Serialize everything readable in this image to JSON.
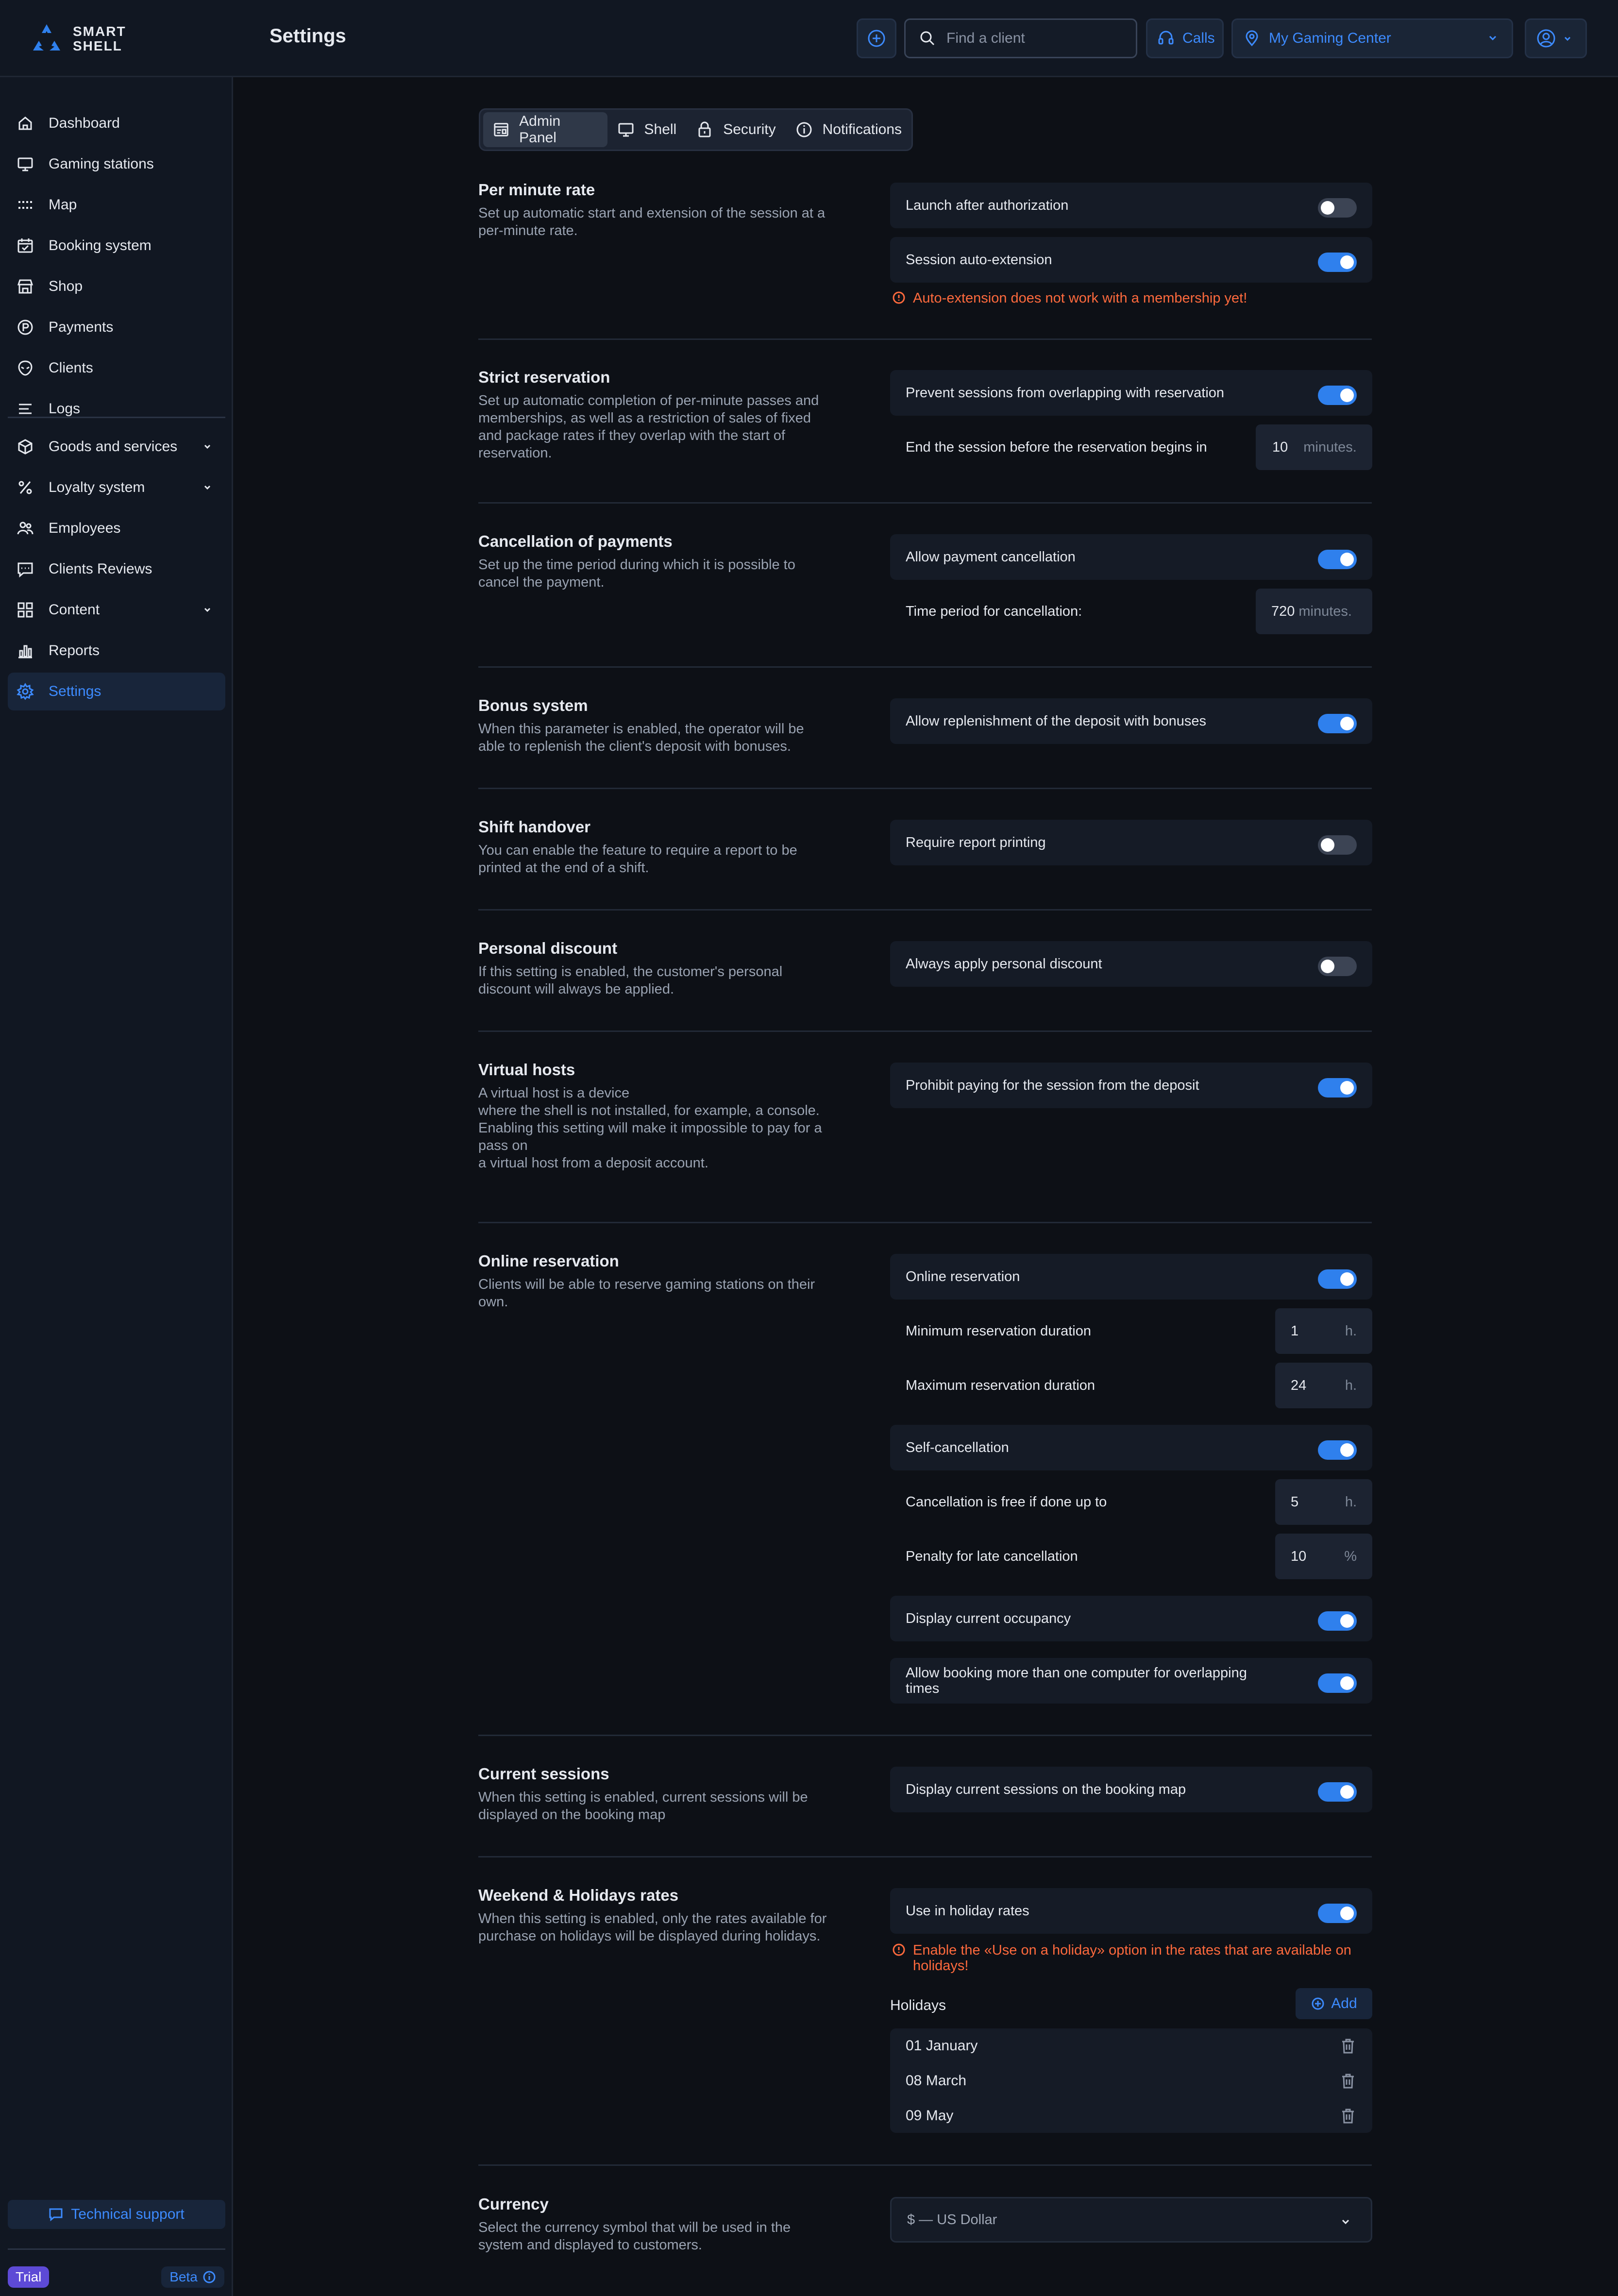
{
  "app": {
    "logo_text_1": "SMART",
    "logo_text_2": "SHELL",
    "page_title": "Settings"
  },
  "header": {
    "search_placeholder": "Find a client",
    "calls_label": "Calls",
    "center_name": "My Gaming Center"
  },
  "sidebar": {
    "items": [
      {
        "label": "Dashboard",
        "icon": "home-icon"
      },
      {
        "label": "Gaming stations",
        "icon": "monitor-icon"
      },
      {
        "label": "Map",
        "icon": "grid-dots-icon"
      },
      {
        "label": "Booking system",
        "icon": "calendar-icon"
      },
      {
        "label": "Shop",
        "icon": "store-icon"
      },
      {
        "label": "Payments",
        "icon": "coin-icon"
      },
      {
        "label": "Clients",
        "icon": "alien-icon"
      },
      {
        "label": "Logs",
        "icon": "list-icon"
      },
      {
        "label": "Goods and services",
        "icon": "box-icon"
      },
      {
        "label": "Loyalty system",
        "icon": "percent-icon"
      },
      {
        "label": "Employees",
        "icon": "people-icon"
      },
      {
        "label": "Clients Reviews",
        "icon": "comment-icon"
      },
      {
        "label": "Content",
        "icon": "blocks-icon"
      },
      {
        "label": "Reports",
        "icon": "bar-chart-icon"
      },
      {
        "label": "Settings",
        "icon": "gear-icon"
      }
    ],
    "support_label": "Technical support",
    "trial_label": "Trial",
    "beta_label": "Beta"
  },
  "tabs": [
    {
      "label": "Admin Panel",
      "icon": "admin-panel-icon"
    },
    {
      "label": "Shell",
      "icon": "monitor-icon"
    },
    {
      "label": "Security",
      "icon": "lock-icon"
    },
    {
      "label": "Notifications",
      "icon": "info-icon"
    }
  ],
  "sections": {
    "per_minute": {
      "title": "Per minute rate",
      "desc": "Set up automatic start and extension of the session at a per-minute rate.",
      "launch_after_auth": "Launch after authorization",
      "auto_extension": "Session auto-extension",
      "warning": "Auto-extension does not work with a membership yet!"
    },
    "strict": {
      "title": "Strict reservation",
      "desc": "Set up automatic completion of per-minute passes and memberships, as well as a restriction of sales of fixed and package rates if they overlap with the start of reservation.",
      "prevent_overlap": "Prevent sessions from overlapping with reservation",
      "end_before": "End the session before the reservation begins in",
      "end_before_value": "10",
      "end_before_unit": "minutes."
    },
    "cancellation": {
      "title": "Cancellation of payments",
      "desc": "Set up the time period during which it is possible to cancel the payment.",
      "allow": "Allow payment cancellation",
      "period": "Time period for cancellation:",
      "period_value": "720",
      "period_unit": "minutes."
    },
    "bonus": {
      "title": "Bonus system",
      "desc": "When this parameter is enabled, the operator will be able to replenish the client's deposit with bonuses.",
      "allow": "Allow replenishment of the deposit with bonuses"
    },
    "shift": {
      "title": "Shift handover",
      "desc": "You can enable the feature to require a report to be printed at the end of a shift.",
      "require": "Require report printing"
    },
    "personal": {
      "title": "Personal discount",
      "desc": "If this setting is enabled, the customer's personal discount will always be applied.",
      "always": "Always apply personal discount"
    },
    "virtual": {
      "title": "Virtual hosts",
      "desc": "A virtual host is a device\nwhere the shell is not installed, for example, a console.\nEnabling this setting will make it impossible to pay for a pass on\na virtual host from a deposit account.",
      "prohibit": "Prohibit paying for the session from the deposit"
    },
    "online": {
      "title": "Online reservation",
      "desc": "Clients will be able to reserve gaming stations on their own.",
      "online_reservation": "Online reservation",
      "min_duration": "Minimum reservation duration",
      "min_value": "1",
      "max_duration": "Maximum reservation duration",
      "max_value": "24",
      "hour_unit": "h.",
      "self_cancel": "Self-cancellation",
      "free_cancel": "Cancellation is free if done up to",
      "free_value": "5",
      "penalty": "Penalty for late cancellation",
      "penalty_value": "10",
      "percent_unit": "%",
      "display_occupancy": "Display current occupancy",
      "allow_multi": "Allow booking more than one computer for overlapping times"
    },
    "current": {
      "title": "Current sessions",
      "desc": "When this setting is enabled, current sessions will be displayed on the booking map",
      "display": "Display current sessions on the booking map"
    },
    "weekend": {
      "title": "Weekend & Holidays rates",
      "desc": "When this setting is enabled, only the rates available for purchase on holidays will be displayed during holidays.",
      "use_holiday": "Use in holiday rates",
      "warning": "Enable the «Use on a holiday» option in the rates that are available on holidays!",
      "holidays_title": "Holidays",
      "add_label": "Add",
      "holidays": [
        "01 January",
        "08 March",
        "09 May"
      ]
    },
    "currency": {
      "title": "Currency",
      "desc": "Select the currency symbol that will be used in the system and displayed to customers.",
      "selected": "$ — US Dollar"
    }
  },
  "colors": {
    "accent": "#2f80ed",
    "link": "#3d8bff",
    "warning": "#ff6a3d",
    "background": "#0d1016",
    "panel": "#111722"
  }
}
